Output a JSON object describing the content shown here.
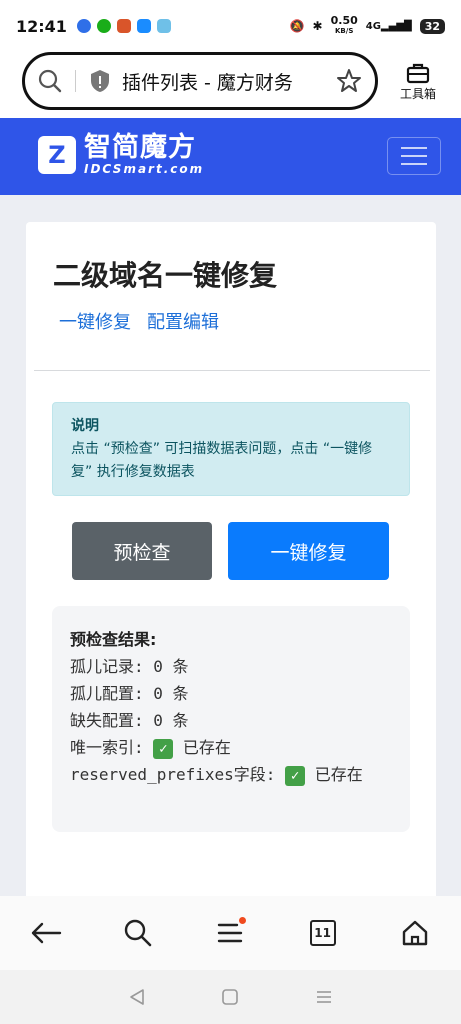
{
  "status_bar": {
    "time": "12:41",
    "net_speed": "0.50",
    "net_unit": "KB/S",
    "network": "4G",
    "battery": "32"
  },
  "browser": {
    "url_title": "插件列表 - 魔方财务",
    "toolbox_label": "工具箱",
    "tab_count": "11"
  },
  "site": {
    "logo_cn": "智简魔方",
    "logo_en": "IDCSmart.com",
    "logo_mark": "Z"
  },
  "card": {
    "title": "二级域名一键修复",
    "links": [
      "一键修复",
      "配置编辑"
    ],
    "alert_title": "说明",
    "alert_text": "点击 “预检查” 可扫描数据表问题，点击 “一键修复” 执行修复数据表",
    "btn_check": "预检查",
    "btn_fix": "一键修复"
  },
  "results": {
    "title": "预检查结果:",
    "lines": [
      "孤儿记录: 0 条",
      "孤儿配置: 0 条",
      "缺失配置: 0 条"
    ],
    "unique_label": "唯一索引:",
    "unique_status": "已存在",
    "field_label": "reserved_prefixes字段:",
    "field_status": "已存在"
  },
  "colors": {
    "header_blue": "#2f55e8",
    "primary_button": "#0a7bfd",
    "secondary_button": "#5a6268",
    "link": "#1d6fd8",
    "alert_bg": "#d1ecf1"
  }
}
